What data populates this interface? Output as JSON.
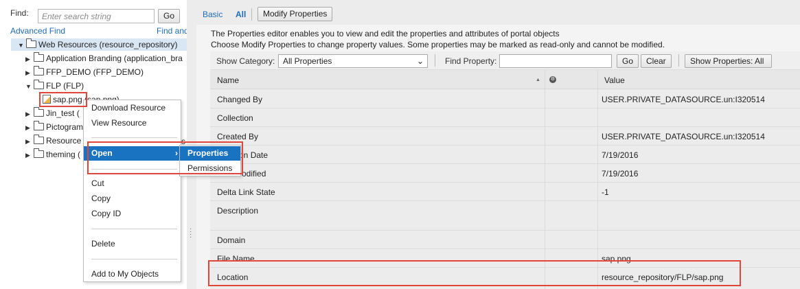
{
  "left": {
    "find_label": "Find:",
    "search_placeholder": "Enter search string",
    "go_label": "Go",
    "advanced_find": "Advanced Find",
    "find_and": "Find and",
    "tree": [
      {
        "label": "Web Resources (resource_repository)",
        "expanded": true
      },
      {
        "label": "Application Branding (application_bra"
      },
      {
        "label": "FFP_DEMO (FFP_DEMO)"
      },
      {
        "label": "FLP (FLP)",
        "expanded": true
      },
      {
        "label": "sap.png (sap.png)"
      },
      {
        "label": "Jin_test ("
      },
      {
        "label": "Pictogram"
      },
      {
        "label": "Resource",
        "suffix": "s"
      },
      {
        "label": "theming ("
      }
    ]
  },
  "context_menu": {
    "items": [
      "Download Resource",
      "View Resource",
      "Open",
      "Cut",
      "Copy",
      "Copy ID",
      "Delete",
      "Add to My Objects"
    ],
    "submenu": [
      "Properties",
      "Permissions"
    ]
  },
  "right": {
    "tabs": [
      "Basic",
      "All"
    ],
    "modify_button": "Modify Properties",
    "desc_line1": "The Properties editor enables you to view and edit the properties and attributes of portal objects",
    "desc_line2": "Choose Modify Properties to change property values. Some properties may be marked as read-only and cannot be modified.",
    "toolbar": {
      "show_category_label": "Show Category:",
      "show_category_value": "All Properties",
      "find_property_label": "Find Property:",
      "go": "Go",
      "clear": "Clear",
      "show_properties": "Show Properties: All"
    },
    "grid": {
      "col_name": "Name",
      "col_value": "Value",
      "rows": [
        {
          "name": "Changed By",
          "value": "USER.PRIVATE_DATASOURCE.un:I320514"
        },
        {
          "name": "Collection",
          "value": ""
        },
        {
          "name": "Created By",
          "value": "USER.PRIVATE_DATASOURCE.un:I320514"
        },
        {
          "name": "Creation Date",
          "value": "7/19/2016"
        },
        {
          "name": "Last Modified",
          "value": "7/19/2016"
        },
        {
          "name": "Delta Link State",
          "value": "-1"
        },
        {
          "name": "Description",
          "value": ""
        },
        {
          "name": "Domain",
          "value": ""
        },
        {
          "name": "File Name",
          "value": "sap.png"
        },
        {
          "name": "Location",
          "value": "resource_repository/FLP/sap.png"
        }
      ]
    }
  },
  "colors": {
    "accent": "#1a73c0",
    "link": "#1f6bb5",
    "highlight_box": "#e0453a"
  }
}
